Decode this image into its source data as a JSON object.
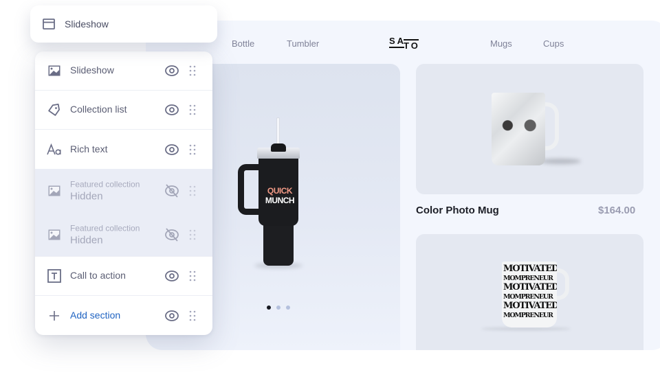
{
  "selected_section": {
    "label": "Slideshow",
    "icon": "layout-icon"
  },
  "sections": [
    {
      "id": "slideshow",
      "label": "Slideshow",
      "icon": "image-icon",
      "visible": true
    },
    {
      "id": "collection-list",
      "label": "Collection list",
      "icon": "tag-icon",
      "visible": true
    },
    {
      "id": "rich-text",
      "label": "Rich text",
      "icon": "text-style-icon",
      "visible": true
    },
    {
      "id": "featured-collection-1",
      "label": "Featured collection",
      "status": "Hidden",
      "icon": "image-icon",
      "visible": false
    },
    {
      "id": "featured-collection-2",
      "label": "Featured collection",
      "status": "Hidden",
      "icon": "image-icon",
      "visible": false
    },
    {
      "id": "call-to-action",
      "label": "Call to action",
      "icon": "text-box-icon",
      "visible": true
    },
    {
      "id": "add-section",
      "label": "Add section",
      "icon": "plus-icon",
      "visible": true
    }
  ],
  "store": {
    "logo": {
      "top": "SA",
      "bottom": "TO"
    },
    "nav": [
      "Bottle",
      "Tumbler",
      "Mugs",
      "Cups"
    ],
    "hero": {
      "product_print": {
        "line1": "QUICK",
        "line2": "MUNCH"
      },
      "slides_total": 3,
      "active_slide": 1
    },
    "products": [
      {
        "name": "Color Photo Mug",
        "price": "$164.00"
      },
      {
        "print_lines": [
          "MOTIVATED",
          "MOMPRENEUR",
          "MOTIVATED",
          "MOMPRENEUR",
          "MOTIVATED",
          "MOMPRENEUR"
        ]
      }
    ]
  },
  "colors": {
    "accent_link": "#1f63c2",
    "text_primary": "#5a5d73",
    "text_muted": "#a7aabd",
    "hidden_row_bg": "#eaedf6",
    "store_bg": "#f3f6fd",
    "price": "#9a9cb1"
  }
}
